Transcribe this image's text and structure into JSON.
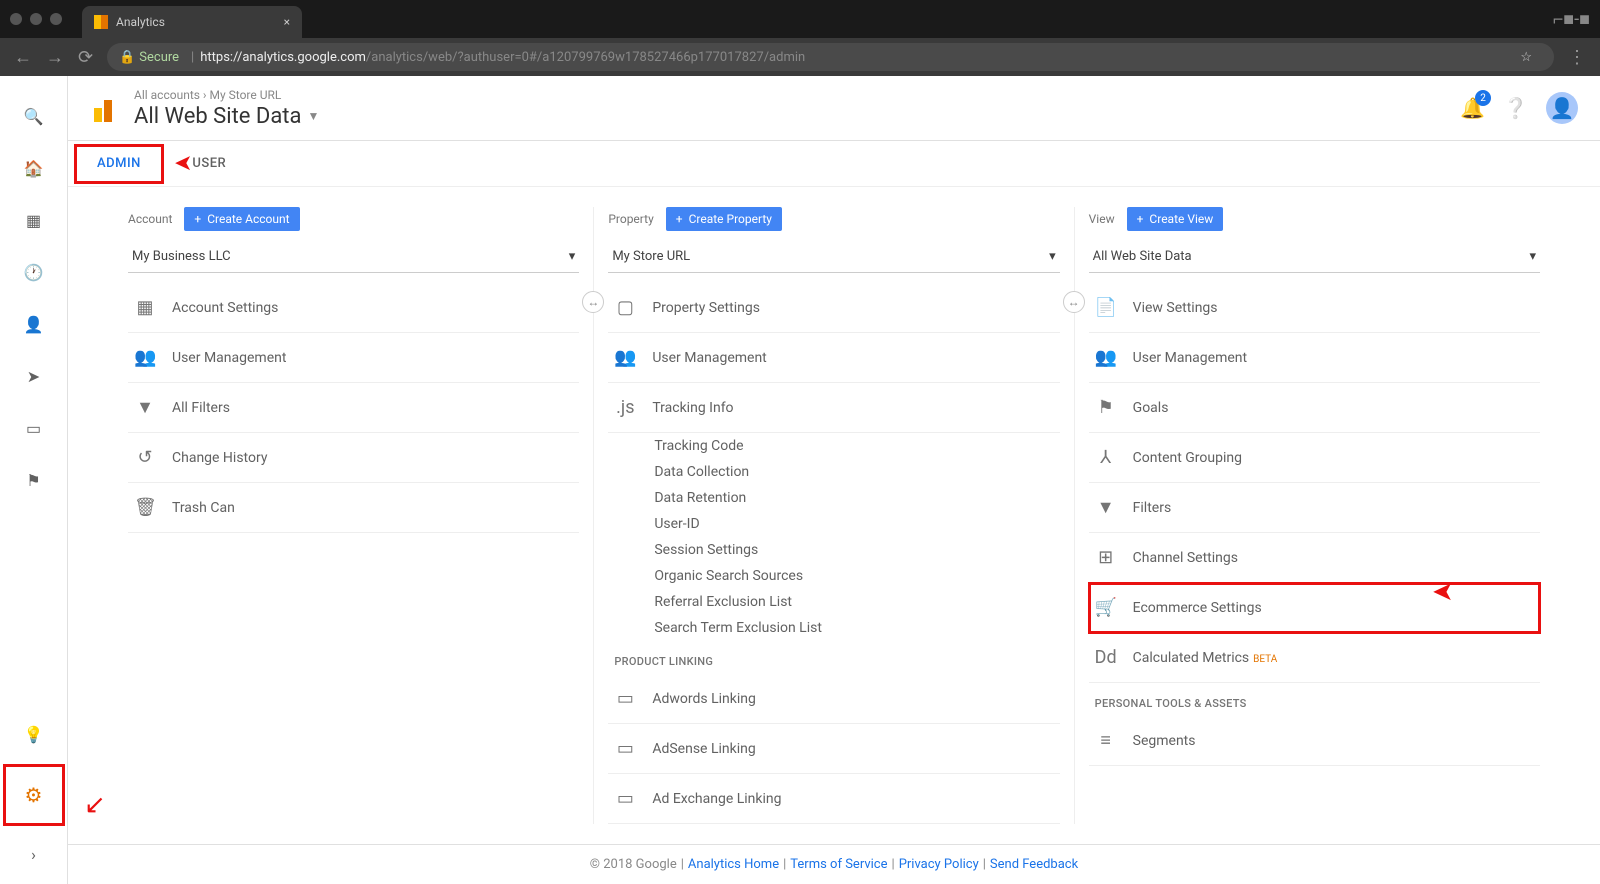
{
  "browser": {
    "tab_title": "Analytics",
    "url_secure": "Secure",
    "url_host": "https://analytics.google.com",
    "url_path": "/analytics/web/?authuser=0#/a120799769w178527466p177017827/admin"
  },
  "header": {
    "breadcrumb_all": "All accounts",
    "breadcrumb_store": "My Store URL",
    "view_title": "All Web Site Data",
    "notif_count": "2"
  },
  "tabs": {
    "admin": "ADMIN",
    "user": "USER"
  },
  "columns": {
    "account": {
      "label": "Account",
      "create": "Create Account",
      "selected": "My Business LLC",
      "items": [
        {
          "icon": "▦",
          "label": "Account Settings"
        },
        {
          "icon": "👥",
          "label": "User Management"
        },
        {
          "icon": "▼",
          "label": "All Filters"
        },
        {
          "icon": "↺",
          "label": "Change History"
        },
        {
          "icon": "🗑",
          "label": "Trash Can"
        }
      ]
    },
    "property": {
      "label": "Property",
      "create": "Create Property",
      "selected": "My Store URL",
      "items": [
        {
          "icon": "▢",
          "label": "Property Settings"
        },
        {
          "icon": "👥",
          "label": "User Management"
        },
        {
          "icon": ".js",
          "label": "Tracking Info"
        }
      ],
      "tracking_sub": [
        "Tracking Code",
        "Data Collection",
        "Data Retention",
        "User-ID",
        "Session Settings",
        "Organic Search Sources",
        "Referral Exclusion List",
        "Search Term Exclusion List"
      ],
      "section1": "PRODUCT LINKING",
      "linking": [
        {
          "icon": "▭",
          "label": "Adwords Linking"
        },
        {
          "icon": "▭",
          "label": "AdSense Linking"
        },
        {
          "icon": "▭",
          "label": "Ad Exchange Linking"
        }
      ]
    },
    "view": {
      "label": "View",
      "create": "Create View",
      "selected": "All Web Site Data",
      "items": [
        {
          "icon": "📄",
          "label": "View Settings"
        },
        {
          "icon": "👥",
          "label": "User Management"
        },
        {
          "icon": "⚑",
          "label": "Goals"
        },
        {
          "icon": "⅄",
          "label": "Content Grouping"
        },
        {
          "icon": "▼",
          "label": "Filters"
        },
        {
          "icon": "⊞",
          "label": "Channel Settings"
        },
        {
          "icon": "🛒",
          "label": "Ecommerce Settings",
          "highlight": true
        },
        {
          "icon": "Dd",
          "label": "Calculated Metrics",
          "beta": "BETA"
        }
      ],
      "section1": "PERSONAL TOOLS & ASSETS",
      "tools": [
        {
          "icon": "≡",
          "label": "Segments"
        }
      ]
    }
  },
  "footer": {
    "copyright": "© 2018 Google",
    "links": [
      "Analytics Home",
      "Terms of Service",
      "Privacy Policy",
      "Send Feedback"
    ]
  }
}
